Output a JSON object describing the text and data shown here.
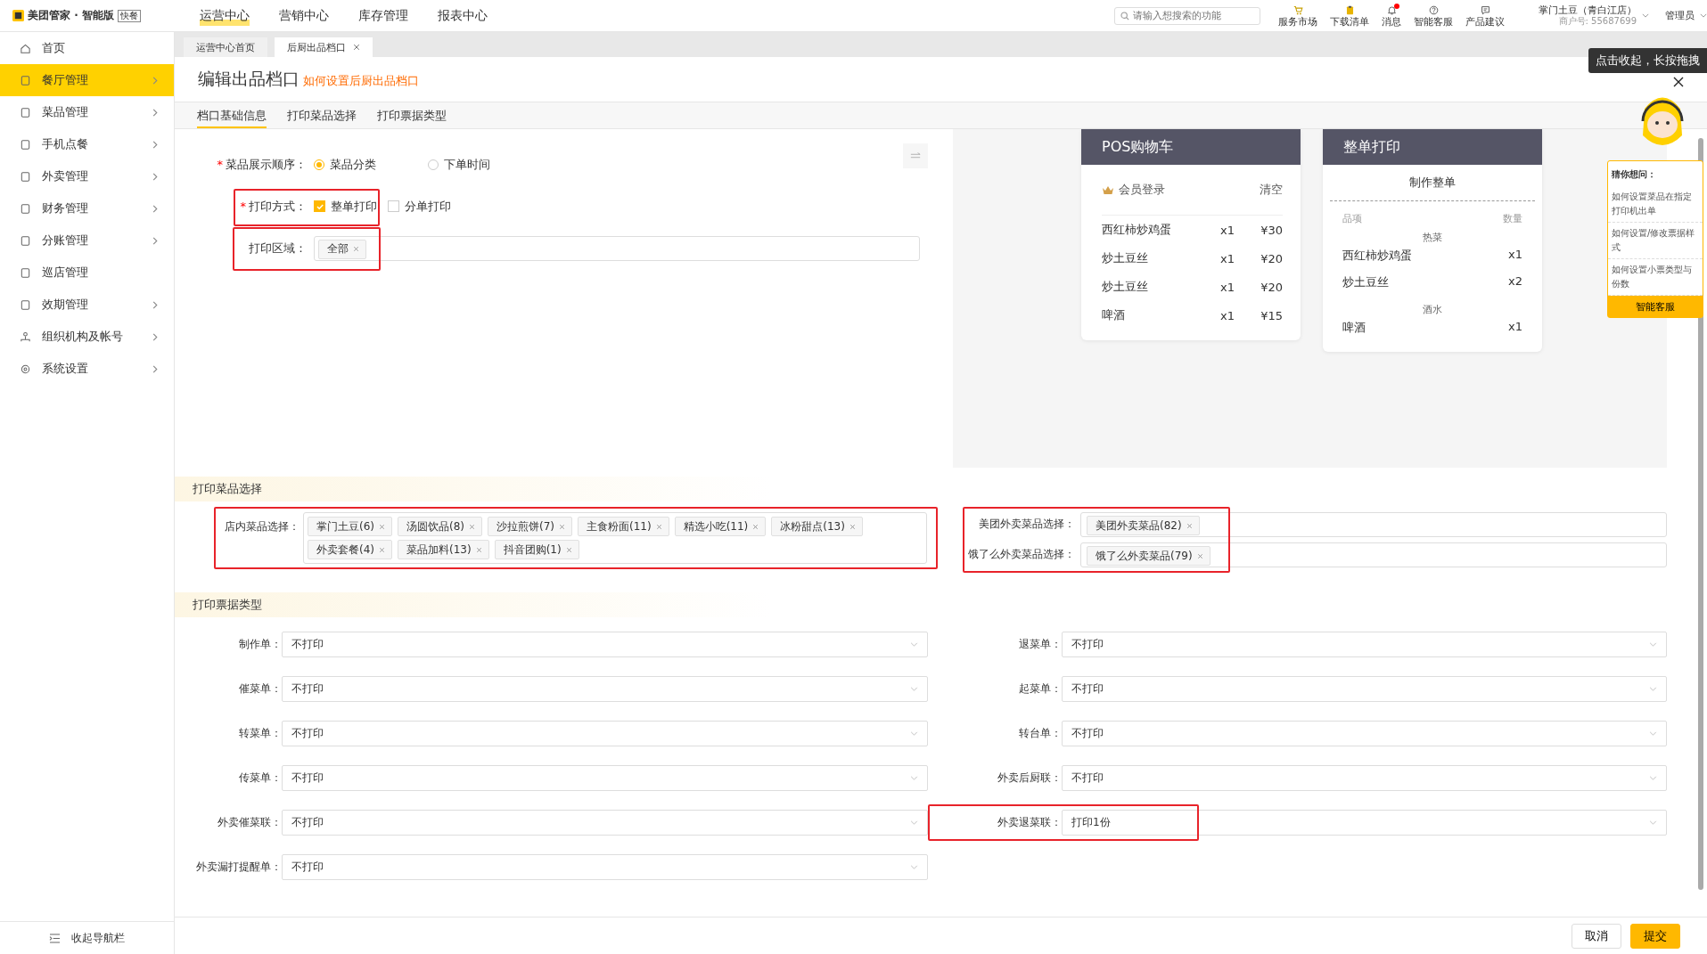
{
  "top_bar": {
    "logo": "美团管家 · 智能版",
    "edition_badge": "快餐",
    "nav": [
      {
        "label": "运营中心",
        "selected": true
      },
      {
        "label": "营销中心",
        "selected": false
      },
      {
        "label": "库存管理",
        "selected": false
      },
      {
        "label": "报表中心",
        "selected": false
      }
    ],
    "search": {
      "placeholder": "请输入想搜索的功能"
    },
    "tools": [
      {
        "kind": "cart",
        "label": "服务市场",
        "badge": false
      },
      {
        "kind": "clipboard",
        "label": "下载清单",
        "badge": false
      },
      {
        "kind": "bell",
        "label": "消息",
        "badge": true
      },
      {
        "kind": "help",
        "label": "智能客服",
        "badge": false
      },
      {
        "kind": "chat",
        "label": "产品建议",
        "badge": false
      }
    ],
    "store": {
      "name": "掌门土豆（青白江店）",
      "merchant_id": "商户号: 55687699"
    },
    "user": "管理员"
  },
  "sidebar": {
    "items": [
      {
        "kind": "home",
        "label": "首页",
        "selected": false,
        "expandable": false
      },
      {
        "kind": "shop",
        "label": "餐厅管理",
        "selected": true,
        "expandable": true
      },
      {
        "kind": "dish",
        "label": "菜品管理",
        "selected": false,
        "expandable": true
      },
      {
        "kind": "phone",
        "label": "手机点餐",
        "selected": false,
        "expandable": true
      },
      {
        "kind": "bag",
        "label": "外卖管理",
        "selected": false,
        "expandable": true
      },
      {
        "kind": "wallet",
        "label": "财务管理",
        "selected": false,
        "expandable": true
      },
      {
        "kind": "split",
        "label": "分账管理",
        "selected": false,
        "expandable": true
      },
      {
        "kind": "patrol",
        "label": "巡店管理",
        "selected": false,
        "expandable": false
      },
      {
        "kind": "clock",
        "label": "效期管理",
        "selected": false,
        "expandable": true
      },
      {
        "kind": "org",
        "label": "组织机构及帐号",
        "selected": false,
        "expandable": true
      },
      {
        "kind": "gear",
        "label": "系统设置",
        "selected": false,
        "expandable": true
      }
    ],
    "collapse": "收起导航栏"
  },
  "page_tabs": [
    {
      "label": "运营中心首页",
      "selected": false,
      "closable": false
    },
    {
      "label": "后厨出品档口",
      "selected": true,
      "closable": true
    }
  ],
  "page": {
    "title": "编辑出品档口",
    "help_link": "如何设置后厨出品档口",
    "tabs": [
      {
        "label": "档口基础信息",
        "selected": true
      },
      {
        "label": "打印菜品选择",
        "selected": false
      },
      {
        "label": "打印票据类型",
        "selected": false
      }
    ]
  },
  "basic": {
    "display_order": {
      "required_mark": "*",
      "label": "菜品展示顺序：",
      "highlighted": false,
      "options": [
        {
          "label": "菜品分类",
          "selected": true
        },
        {
          "label": "下单时间",
          "selected": false
        }
      ]
    },
    "print_mode": {
      "required_mark": "*",
      "label": "打印方式：",
      "highlighted": true,
      "options": [
        {
          "label": "整单打印",
          "checked": true
        },
        {
          "label": "分单打印",
          "checked": false
        }
      ]
    },
    "print_area": {
      "label": "打印区域：",
      "highlighted": true,
      "tags": [
        "全部"
      ]
    }
  },
  "preview": {
    "pos_cart": {
      "title": "POS购物车",
      "member_login": "会员登录",
      "clear": "清空",
      "items": [
        {
          "name": "西红柿炒鸡蛋",
          "qty": "x1",
          "price": "¥30"
        },
        {
          "name": "炒土豆丝",
          "qty": "x1",
          "price": "¥20"
        },
        {
          "name": "炒土豆丝",
          "qty": "x1",
          "price": "¥20"
        },
        {
          "name": "啤酒",
          "qty": "x1",
          "price": "¥15"
        }
      ]
    },
    "ticket": {
      "title": "整单打印",
      "heading": "制作整单",
      "col_item": "品项",
      "col_qty": "数量",
      "groups": [
        {
          "category": "热菜",
          "items": [
            {
              "name": "西红柿炒鸡蛋",
              "qty": "x1"
            },
            {
              "name": "炒土豆丝",
              "qty": "x2"
            }
          ]
        },
        {
          "category": "酒水",
          "items": [
            {
              "name": "啤酒",
              "qty": "x1"
            }
          ]
        }
      ]
    }
  },
  "dish_selection": {
    "title": "打印菜品选择",
    "store": {
      "label": "店内菜品选择：",
      "highlighted": true,
      "tags": [
        "掌门土豆(6)",
        "汤圆饮品(8)",
        "沙拉煎饼(7)",
        "主食粉面(11)",
        "精选小吃(11)",
        "冰粉甜点(13)",
        "外卖套餐(4)",
        "菜品加料(13)",
        "抖音团购(1)"
      ]
    },
    "takeaway_highlighted": true,
    "takeaway": [
      {
        "label": "美团外卖菜品选择：",
        "tags": [
          "美团外卖菜品(82)"
        ]
      },
      {
        "label": "饿了么外卖菜品选择：",
        "tags": [
          "饿了么外卖菜品(79)"
        ]
      }
    ]
  },
  "ticket_types": {
    "title": "打印票据类型",
    "left": [
      {
        "label": "制作单：",
        "value": "不打印",
        "highlighted": false
      },
      {
        "label": "催菜单：",
        "value": "不打印",
        "highlighted": false
      },
      {
        "label": "转菜单：",
        "value": "不打印",
        "highlighted": false
      },
      {
        "label": "传菜单：",
        "value": "不打印",
        "highlighted": false
      },
      {
        "label": "外卖催菜联：",
        "value": "不打印",
        "highlighted": false
      },
      {
        "label": "外卖漏打提醒单：",
        "value": "不打印",
        "highlighted": false
      }
    ],
    "right": [
      {
        "label": "退菜单：",
        "value": "不打印",
        "highlighted": false
      },
      {
        "label": "起菜单：",
        "value": "不打印",
        "highlighted": false
      },
      {
        "label": "转台单：",
        "value": "不打印",
        "highlighted": false
      },
      {
        "label": "外卖后厨联：",
        "value": "不打印",
        "highlighted": false
      },
      {
        "label": "外卖退菜联：",
        "value": "打印1份",
        "highlighted": true
      }
    ]
  },
  "footer": {
    "cancel": "取消",
    "submit": "提交"
  },
  "assistant": {
    "tooltip": "点击收起，长按拖拽",
    "title": "猜你想问：",
    "questions": [
      "如何设置菜品在指定打印机出单",
      "如何设置/修改票据样式",
      "如何设置小票类型与份数"
    ],
    "button": "智能客服"
  }
}
